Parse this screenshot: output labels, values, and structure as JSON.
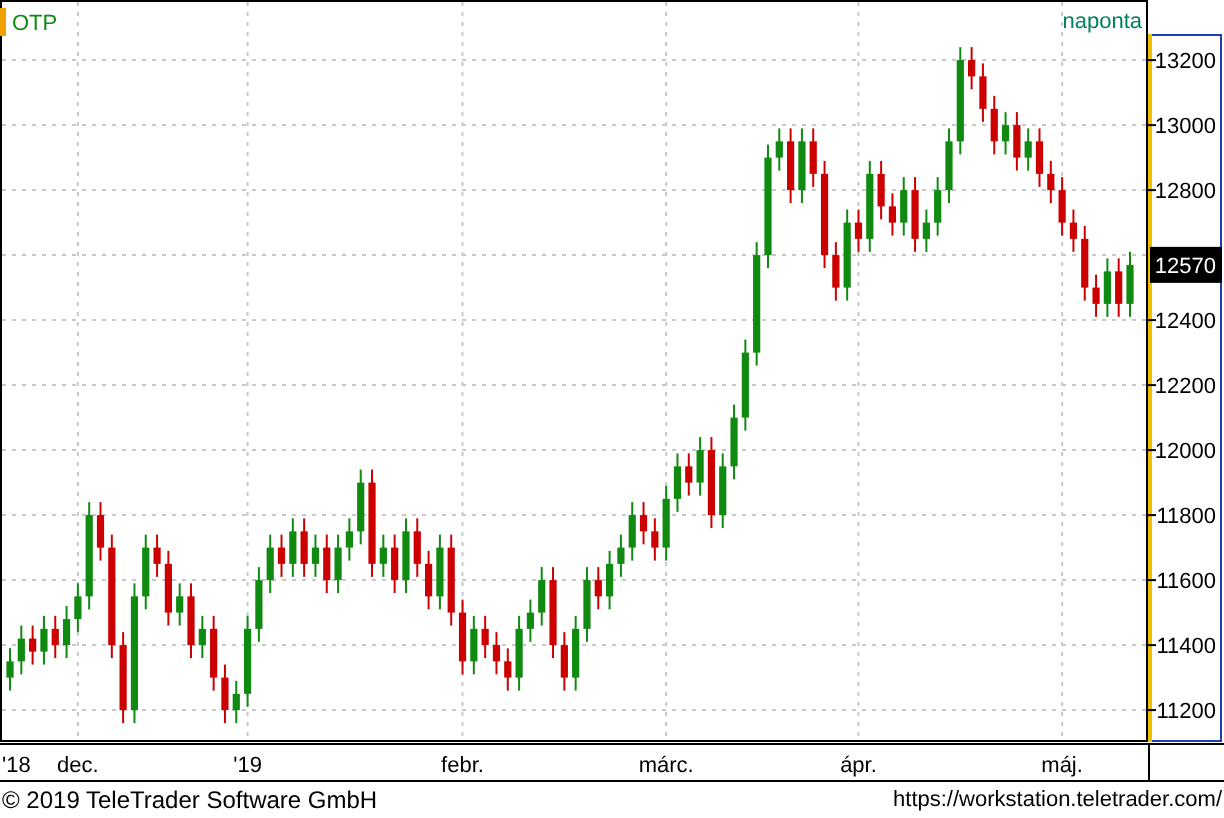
{
  "header": {
    "interval": "naponta"
  },
  "last_price": "12570",
  "chart_data": {
    "type": "candlestick",
    "ylim": [
      11108,
      13385
    ],
    "grid": true,
    "categories": [
      "'18",
      null,
      null,
      null,
      null,
      null,
      "dec.",
      null,
      null,
      null,
      null,
      null,
      null,
      null,
      null,
      null,
      null,
      null,
      null,
      null,
      null,
      "'19",
      null,
      null,
      null,
      null,
      null,
      null,
      null,
      null,
      null,
      null,
      null,
      null,
      null,
      null,
      null,
      null,
      null,
      null,
      "febr.",
      null,
      null,
      null,
      null,
      null,
      null,
      null,
      null,
      null,
      null,
      null,
      null,
      null,
      null,
      null,
      null,
      null,
      "márc.",
      null,
      null,
      null,
      null,
      null,
      null,
      null,
      null,
      null,
      null,
      null,
      null,
      null,
      null,
      null,
      null,
      "ápr.",
      null,
      null,
      null,
      null,
      null,
      null,
      null,
      null,
      null,
      null,
      null,
      null,
      null,
      null,
      null,
      null,
      null,
      "máj.",
      null,
      null,
      null,
      null,
      null,
      null
    ],
    "series": [
      {
        "name": "OTP",
        "ohlc": [
          [
            11300,
            11390,
            11260,
            11350
          ],
          [
            11350,
            11460,
            11310,
            11420
          ],
          [
            11420,
            11460,
            11340,
            11380
          ],
          [
            11380,
            11490,
            11340,
            11450
          ],
          [
            11450,
            11490,
            11360,
            11400
          ],
          [
            11400,
            11520,
            11360,
            11480
          ],
          [
            11480,
            11590,
            11440,
            11550
          ],
          [
            11550,
            11840,
            11510,
            11800
          ],
          [
            11800,
            11840,
            11660,
            11700
          ],
          [
            11700,
            11740,
            11360,
            11400
          ],
          [
            11400,
            11440,
            11160,
            11200
          ],
          [
            11200,
            11590,
            11160,
            11550
          ],
          [
            11550,
            11740,
            11510,
            11700
          ],
          [
            11700,
            11740,
            11610,
            11650
          ],
          [
            11650,
            11690,
            11460,
            11500
          ],
          [
            11500,
            11590,
            11460,
            11550
          ],
          [
            11550,
            11590,
            11360,
            11400
          ],
          [
            11400,
            11490,
            11360,
            11450
          ],
          [
            11450,
            11490,
            11260,
            11300
          ],
          [
            11300,
            11340,
            11160,
            11200
          ],
          [
            11200,
            11290,
            11160,
            11250
          ],
          [
            11250,
            11490,
            11210,
            11450
          ],
          [
            11450,
            11640,
            11410,
            11600
          ],
          [
            11600,
            11740,
            11560,
            11700
          ],
          [
            11700,
            11740,
            11610,
            11650
          ],
          [
            11650,
            11790,
            11610,
            11750
          ],
          [
            11750,
            11790,
            11610,
            11650
          ],
          [
            11650,
            11740,
            11610,
            11700
          ],
          [
            11700,
            11740,
            11560,
            11600
          ],
          [
            11600,
            11740,
            11560,
            11700
          ],
          [
            11700,
            11790,
            11660,
            11750
          ],
          [
            11750,
            11940,
            11710,
            11900
          ],
          [
            11900,
            11940,
            11610,
            11650
          ],
          [
            11650,
            11740,
            11610,
            11700
          ],
          [
            11700,
            11740,
            11560,
            11600
          ],
          [
            11600,
            11790,
            11560,
            11750
          ],
          [
            11750,
            11790,
            11610,
            11650
          ],
          [
            11650,
            11690,
            11510,
            11550
          ],
          [
            11550,
            11740,
            11510,
            11700
          ],
          [
            11700,
            11740,
            11460,
            11500
          ],
          [
            11500,
            11540,
            11310,
            11350
          ],
          [
            11350,
            11490,
            11310,
            11450
          ],
          [
            11450,
            11490,
            11360,
            11400
          ],
          [
            11400,
            11440,
            11310,
            11350
          ],
          [
            11350,
            11390,
            11260,
            11300
          ],
          [
            11300,
            11490,
            11260,
            11450
          ],
          [
            11450,
            11540,
            11410,
            11500
          ],
          [
            11500,
            11640,
            11460,
            11600
          ],
          [
            11600,
            11640,
            11360,
            11400
          ],
          [
            11400,
            11440,
            11260,
            11300
          ],
          [
            11300,
            11490,
            11260,
            11450
          ],
          [
            11450,
            11640,
            11410,
            11600
          ],
          [
            11600,
            11640,
            11510,
            11550
          ],
          [
            11550,
            11690,
            11510,
            11650
          ],
          [
            11650,
            11740,
            11610,
            11700
          ],
          [
            11700,
            11840,
            11660,
            11800
          ],
          [
            11800,
            11840,
            11710,
            11750
          ],
          [
            11750,
            11790,
            11660,
            11700
          ],
          [
            11700,
            11890,
            11660,
            11850
          ],
          [
            11850,
            11990,
            11810,
            11950
          ],
          [
            11950,
            11990,
            11860,
            11900
          ],
          [
            11900,
            12040,
            11860,
            12000
          ],
          [
            12000,
            12040,
            11760,
            11800
          ],
          [
            11800,
            11990,
            11760,
            11950
          ],
          [
            11950,
            12140,
            11910,
            12100
          ],
          [
            12100,
            12340,
            12060,
            12300
          ],
          [
            12300,
            12640,
            12260,
            12600
          ],
          [
            12600,
            12940,
            12560,
            12900
          ],
          [
            12900,
            12990,
            12860,
            12950
          ],
          [
            12950,
            12990,
            12760,
            12800
          ],
          [
            12800,
            12990,
            12760,
            12950
          ],
          [
            12950,
            12990,
            12810,
            12850
          ],
          [
            12850,
            12890,
            12560,
            12600
          ],
          [
            12600,
            12640,
            12460,
            12500
          ],
          [
            12500,
            12740,
            12460,
            12700
          ],
          [
            12700,
            12740,
            12610,
            12650
          ],
          [
            12650,
            12890,
            12610,
            12850
          ],
          [
            12850,
            12890,
            12710,
            12750
          ],
          [
            12750,
            12790,
            12660,
            12700
          ],
          [
            12700,
            12840,
            12660,
            12800
          ],
          [
            12800,
            12840,
            12610,
            12650
          ],
          [
            12650,
            12740,
            12610,
            12700
          ],
          [
            12700,
            12840,
            12660,
            12800
          ],
          [
            12800,
            12990,
            12760,
            12950
          ],
          [
            12950,
            13240,
            12910,
            13200
          ],
          [
            13200,
            13240,
            13110,
            13150
          ],
          [
            13150,
            13190,
            13010,
            13050
          ],
          [
            13050,
            13090,
            12910,
            12950
          ],
          [
            12950,
            13040,
            12910,
            13000
          ],
          [
            13000,
            13040,
            12860,
            12900
          ],
          [
            12900,
            12990,
            12860,
            12950
          ],
          [
            12950,
            12990,
            12810,
            12850
          ],
          [
            12850,
            12890,
            12760,
            12800
          ],
          [
            12800,
            12840,
            12660,
            12700
          ],
          [
            12700,
            12740,
            12610,
            12650
          ],
          [
            12650,
            12690,
            12460,
            12500
          ],
          [
            12500,
            12540,
            12410,
            12450
          ],
          [
            12450,
            12590,
            12410,
            12550
          ],
          [
            12550,
            12590,
            12410,
            12450
          ],
          [
            12450,
            12610,
            12410,
            12570
          ]
        ]
      }
    ],
    "yticks": [
      11200,
      11400,
      11600,
      11800,
      12000,
      12200,
      12400,
      12800,
      13000,
      13200
    ]
  },
  "footer": {
    "copyright": "© 2019 TeleTrader Software GmbH",
    "url": "https://workstation.teletrader.com/"
  }
}
